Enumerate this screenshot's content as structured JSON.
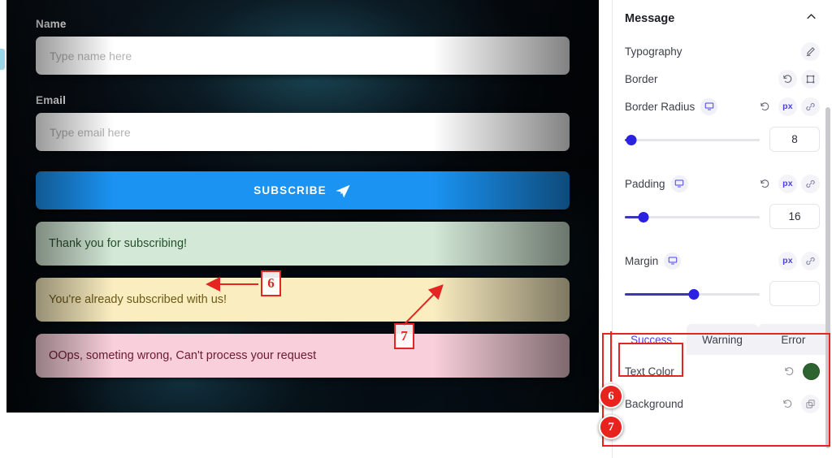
{
  "preview": {
    "name_label": "Name",
    "name_placeholder": "Type name here",
    "name_value": "",
    "email_label": "Email",
    "email_placeholder": "Type email here",
    "email_value": "",
    "subscribe_label": "SUBSCRIBE",
    "subscribe_icon": "send-icon",
    "subscribe_color": "#1b93f2",
    "alerts": [
      {
        "state": "success",
        "text": "Thank you for subscribing!",
        "bg": "#d3e8d6",
        "fg": "#27502d"
      },
      {
        "state": "warning",
        "text": "You're already subscribed with us!",
        "bg": "#faedc0",
        "fg": "#6d5a16"
      },
      {
        "state": "error",
        "text": "OOps, someting wrong, Can't process your request",
        "bg": "#f8cfda",
        "fg": "#6d1a32"
      }
    ]
  },
  "annotations": {
    "marker_6": "6",
    "marker_7": "7",
    "callout_color": "#e52521"
  },
  "panel": {
    "section_title": "Message",
    "collapse_icon": "chevron-up-icon",
    "rows": [
      {
        "label": "Typography",
        "device_icon": null,
        "actions": [
          "pencil-icon"
        ]
      },
      {
        "label": "Border",
        "device_icon": null,
        "actions": [
          "reset-icon",
          "border-box-icon"
        ]
      },
      {
        "label": "Border Radius",
        "device_icon": "monitor-icon",
        "actions": [
          "reset-icon",
          "px",
          "link-icon"
        ]
      }
    ],
    "border_radius": {
      "value": "8",
      "unit": "px",
      "slider_percent": 5
    },
    "padding": {
      "label": "Padding",
      "device_icon": "monitor-icon",
      "value": "16",
      "unit": "px",
      "slider_percent": 14,
      "actions": [
        "reset-icon",
        "px",
        "link-icon"
      ]
    },
    "margin": {
      "label": "Margin",
      "device_icon": "monitor-icon",
      "value": "",
      "unit": "px",
      "slider_percent": 51,
      "actions": [
        "px",
        "link-icon"
      ]
    },
    "state_tabs": [
      {
        "label": "Success",
        "active": true
      },
      {
        "label": "Warning",
        "active": false
      },
      {
        "label": "Error",
        "active": false
      }
    ],
    "color_rows": [
      {
        "label": "Text Color",
        "actions": [
          "reset-icon"
        ],
        "swatch": "#2d6330"
      },
      {
        "label": "Background",
        "actions": [
          "reset-icon",
          "copy-layers-icon"
        ],
        "swatch": null
      }
    ],
    "accent_color": "#4a40e8",
    "slider_color": "#2a22e0"
  }
}
